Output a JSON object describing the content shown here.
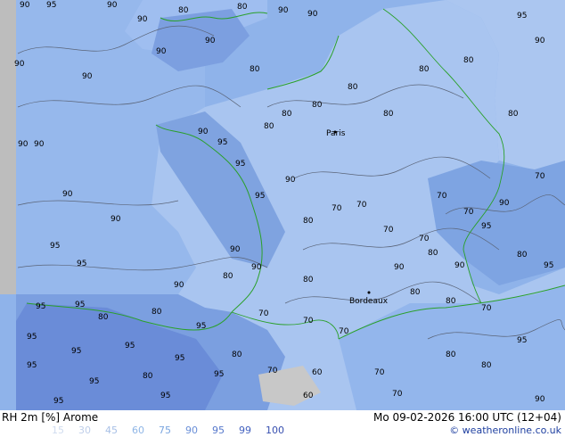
{
  "map": {
    "contour_values": [
      "90",
      "95",
      "80",
      "70",
      "60"
    ],
    "cities": [
      {
        "name": "Paris"
      },
      {
        "name": "Bordeaux"
      }
    ]
  },
  "footer": {
    "title": "RH 2m [%] Arome",
    "valid_time": "Mo 09-02-2026 16:00 UTC (12+04)",
    "credit": "© weatheronline.co.uk",
    "legend": [
      {
        "value": "15",
        "color": "#d8e4f4"
      },
      {
        "value": "30",
        "color": "#c6d8ef"
      },
      {
        "value": "45",
        "color": "#b2cbe9"
      },
      {
        "value": "60",
        "color": "#8fb6e6"
      },
      {
        "value": "75",
        "color": "#7aa5df"
      },
      {
        "value": "90",
        "color": "#6a8fd8"
      },
      {
        "value": "95",
        "color": "#5678cc"
      },
      {
        "value": "99",
        "color": "#4462c0"
      },
      {
        "value": "100",
        "color": "#3850b0"
      }
    ]
  },
  "colors": {
    "land": "#a6c3ef",
    "sea": "#8fb3ea",
    "high_rh": "#6f94dc",
    "very_high_rh": "#5a7fd2",
    "coast": "#2aa02a",
    "border": "#2aa02a",
    "contour": "#5a6478"
  }
}
